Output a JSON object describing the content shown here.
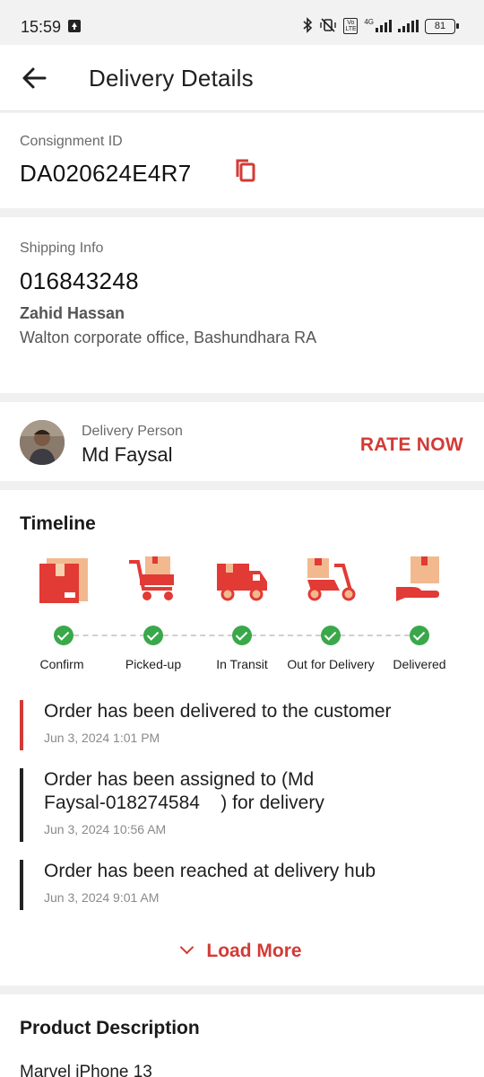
{
  "status_bar": {
    "time": "15:59",
    "battery": "81",
    "network": "4G"
  },
  "header": {
    "title": "Delivery Details",
    "back_icon": "arrow-left-icon"
  },
  "consignment": {
    "label": "Consignment ID",
    "id": "DA020624E4R7",
    "copy_icon": "copy-icon"
  },
  "shipping": {
    "label": "Shipping Info",
    "phone": "016843248",
    "name": "Zahid Hassan",
    "address": "Walton corporate office, Bashundhara RA"
  },
  "delivery_person": {
    "label": "Delivery Person",
    "name": "Md Faysal",
    "rate_label": "RATE NOW"
  },
  "timeline": {
    "title": "Timeline",
    "steps": [
      {
        "label": "Confirm",
        "icon": "box-icon",
        "done": true
      },
      {
        "label": "Picked-up",
        "icon": "cart-icon",
        "done": true
      },
      {
        "label": "In Transit",
        "icon": "truck-icon",
        "done": true
      },
      {
        "label": "Out for Delivery",
        "icon": "scooter-icon",
        "done": true
      },
      {
        "label": "Delivered",
        "icon": "hand-box-icon",
        "done": true
      }
    ],
    "events": [
      {
        "text": "Order has been delivered to the customer",
        "time": "Jun 3, 2024 1:01 PM"
      },
      {
        "text_line1": "Order has been assigned to (Md",
        "text_line2": "Faysal-018274584    ) for delivery",
        "time": "Jun 3, 2024 10:56 AM"
      },
      {
        "text": "Order has been reached at delivery hub",
        "time": "Jun 3, 2024 9:01 AM"
      }
    ],
    "load_more": "Load More"
  },
  "product": {
    "title": "Product Description",
    "item": "Marvel iPhone 13"
  },
  "colors": {
    "accent": "#d33a36",
    "success": "#3aa84a",
    "icon_light": "#f2b98f"
  }
}
